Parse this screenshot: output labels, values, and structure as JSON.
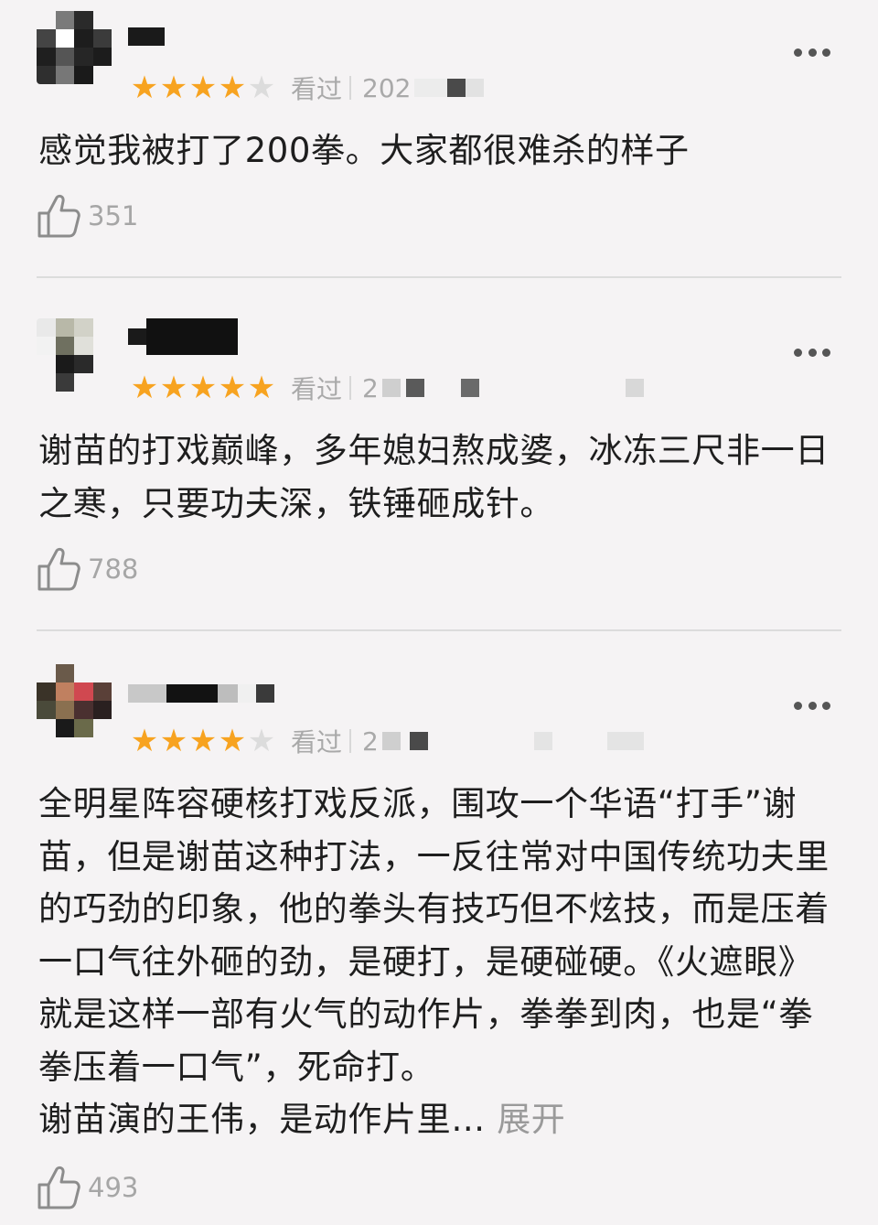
{
  "reviews": [
    {
      "rating": 4,
      "status_label": "看过",
      "date_partial": "202",
      "content": "感觉我被打了200拳。大家都很难杀的样子",
      "likes": "351"
    },
    {
      "rating": 5,
      "status_label": "看过",
      "date_partial": "2",
      "content": "谢苗的打戏巅峰，多年媳妇熬成婆，冰冻三尺非一日之寒，只要功夫深，铁锤砸成针。",
      "likes": "788"
    },
    {
      "rating": 4,
      "status_label": "看过",
      "date_partial": "2",
      "content": "全明星阵容硬核打戏反派，围攻一个华语“打手”谢苗，但是谢苗这种打法，一反往常对中国传统功夫里的巧劲的印象，他的拳头有技巧但不炫技，而是压着一口气往外砸的劲，是硬打，是硬碰硬。《火遮眼》就是这样一部有火气的动作片，拳拳到肉，也是“拳拳压着一口气”，死命打。\n谢苗演的王伟，是动作片里…",
      "expand_label": "展开",
      "likes": "493"
    }
  ],
  "colors": {
    "star_on": "#f7a320",
    "star_off": "#dcdcdc",
    "background": "#f5f3f4"
  },
  "icons": {
    "like": "thumbs-up-icon",
    "more": "more-dots-icon"
  }
}
